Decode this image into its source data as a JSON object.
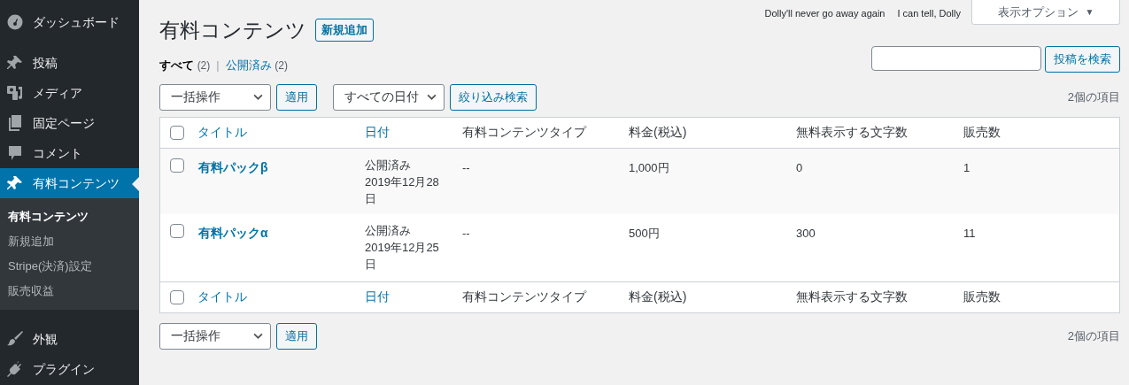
{
  "sidebar": {
    "items": [
      {
        "label": "ダッシュボード",
        "selected": false
      },
      {
        "label": "投稿",
        "selected": false
      },
      {
        "label": "メディア",
        "selected": false
      },
      {
        "label": "固定ページ",
        "selected": false
      },
      {
        "label": "コメント",
        "selected": false
      },
      {
        "label": "有料コンテンツ",
        "selected": true,
        "children": [
          {
            "label": "有料コンテンツ",
            "selected": true
          },
          {
            "label": "新規追加",
            "selected": false
          },
          {
            "label": "Stripe(決済)設定",
            "selected": false
          },
          {
            "label": "販売収益",
            "selected": false
          }
        ]
      },
      {
        "label": "外観",
        "selected": false
      },
      {
        "label": "プラグイン",
        "selected": false
      }
    ]
  },
  "top_links": [
    "Dolly'll never go away again",
    "I can tell, Dolly"
  ],
  "screen_options": {
    "label": "表示オプション",
    "caret": "▼"
  },
  "header": {
    "title": "有料コンテンツ",
    "add_button": "新規追加"
  },
  "filters": [
    {
      "label": "すべて",
      "count": "(2)",
      "selected": true
    },
    {
      "label": "公開済み",
      "count": "(2)",
      "selected": false
    }
  ],
  "filter_separator": "|",
  "search": {
    "button": "投稿を検索"
  },
  "tablenav_top": {
    "bulk_action": "一括操作",
    "apply": "適用",
    "date_filter": "すべての日付",
    "filter_button": "絞り込み検索",
    "count": "2個の項目"
  },
  "table": {
    "columns": [
      {
        "label": "タイトル",
        "kind": "link"
      },
      {
        "label": "日付",
        "kind": "link"
      },
      {
        "label": "有料コンテンツタイプ",
        "kind": "plain"
      },
      {
        "label": "料金(税込)",
        "kind": "plain"
      },
      {
        "label": "無料表示する文字数",
        "kind": "plain"
      },
      {
        "label": "販売数",
        "kind": "plain"
      }
    ],
    "rows": [
      {
        "checked": false,
        "title": "有料パックβ",
        "status": "公開済み",
        "date": "2019年12月28日",
        "type": "--",
        "price": "1,000円",
        "chars": "0",
        "sales": "1"
      },
      {
        "checked": false,
        "title": "有料パックα",
        "status": "公開済み",
        "date": "2019年12月25日",
        "type": "--",
        "price": "500円",
        "chars": "300",
        "sales": "11"
      }
    ],
    "footer_columns": [
      {
        "label": "タイトル",
        "kind": "link"
      },
      {
        "label": "日付",
        "kind": "link"
      },
      {
        "label": "有料コンテンツタイプ",
        "kind": "plain"
      },
      {
        "label": "料金(税込)",
        "kind": "plain"
      },
      {
        "label": "無料表示する文字数",
        "kind": "plain"
      },
      {
        "label": "販売数",
        "kind": "plain"
      }
    ],
    "header_checked": false,
    "footer_checked": false
  },
  "tablenav_bottom": {
    "bulk_action": "一括操作",
    "apply": "適用",
    "count": "2個の項目"
  }
}
